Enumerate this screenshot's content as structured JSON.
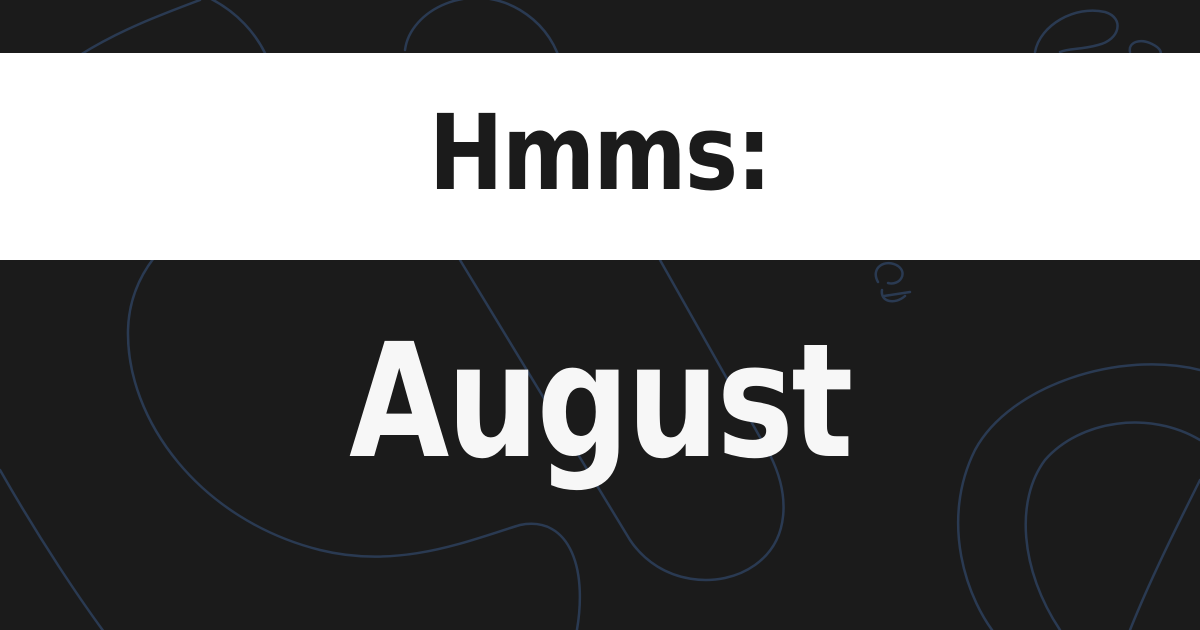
{
  "heading": "Hmms:",
  "subheading": "August",
  "colors": {
    "background": "#1b1b1b",
    "band": "#ffffff",
    "heading_text": "#1b1b1b",
    "subheading_text": "#f7f7f7",
    "decoration_stroke": "#2a3a52"
  }
}
